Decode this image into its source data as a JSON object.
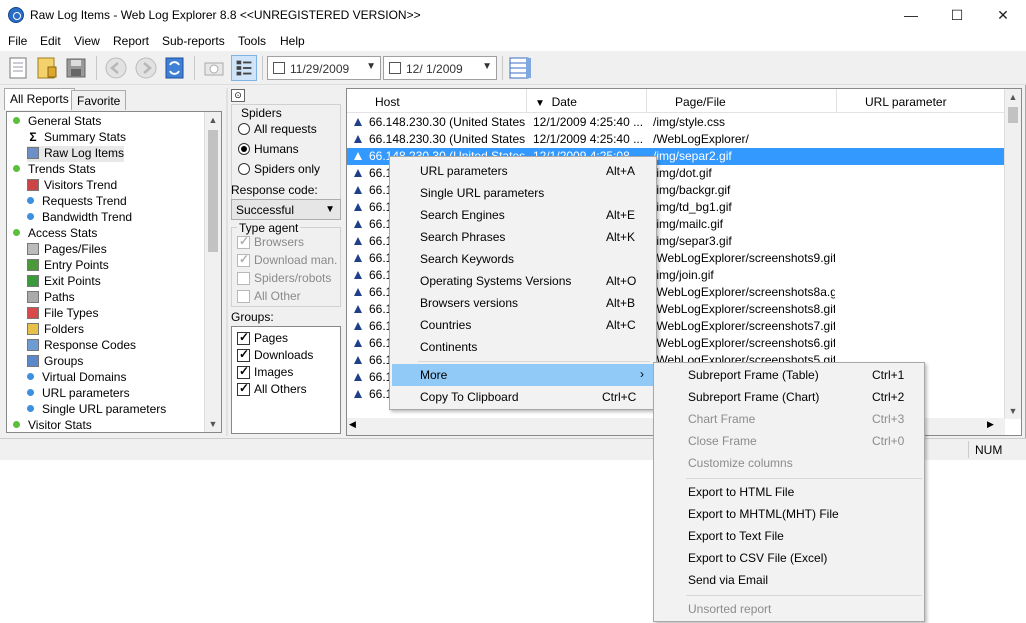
{
  "window": {
    "title": "Raw Log Items - Web Log Explorer 8.8 <<UNREGISTERED VERSION>>",
    "minimize": "—",
    "maximize": "☐",
    "close": "✕"
  },
  "menubar": [
    "File",
    "Edit",
    "View",
    "Report",
    "Sub-reports",
    "Tools",
    "Help"
  ],
  "toolbar": {
    "date_from": "11/29/2009",
    "date_to": "12/  1/2009",
    "icons": [
      "new-report-icon",
      "open-icon",
      "save-icon",
      "back-icon",
      "forward-icon",
      "refresh-icon",
      "snapshot-icon",
      "filter-panel-icon",
      "columns-icon"
    ]
  },
  "left_panel": {
    "tabs": [
      "All Reports",
      "Favorite"
    ],
    "tree": [
      {
        "label": "General Stats",
        "level": 0,
        "icon": "dot-green"
      },
      {
        "label": "Summary Stats",
        "level": 1,
        "icon": "sigma-icon"
      },
      {
        "label": "Raw Log Items",
        "level": 1,
        "icon": "list-icon"
      },
      {
        "label": "Trends Stats",
        "level": 0,
        "icon": "dot-green"
      },
      {
        "label": "Visitors Trend",
        "level": 1,
        "icon": "visitors-icon"
      },
      {
        "label": "Requests Trend",
        "level": 1,
        "icon": "dot-blue"
      },
      {
        "label": "Bandwidth Trend",
        "level": 1,
        "icon": "dot-blue"
      },
      {
        "label": "Access Stats",
        "level": 0,
        "icon": "dot-green"
      },
      {
        "label": "Pages/Files",
        "level": 1,
        "icon": "pages-icon"
      },
      {
        "label": "Entry Points",
        "level": 1,
        "icon": "entry-icon"
      },
      {
        "label": "Exit Points",
        "level": 1,
        "icon": "exit-icon"
      },
      {
        "label": "Paths",
        "level": 1,
        "icon": "paths-icon"
      },
      {
        "label": "File Types",
        "level": 1,
        "icon": "filetypes-icon"
      },
      {
        "label": "Folders",
        "level": 1,
        "icon": "folder-icon"
      },
      {
        "label": "Response Codes",
        "level": 1,
        "icon": "response-icon"
      },
      {
        "label": "Groups",
        "level": 1,
        "icon": "groups-icon"
      },
      {
        "label": "Virtual Domains",
        "level": 1,
        "icon": "dot-blue"
      },
      {
        "label": "URL parameters",
        "level": 1,
        "icon": "dot-blue"
      },
      {
        "label": "Single URL parameters",
        "level": 1,
        "icon": "dot-blue"
      },
      {
        "label": "Visitor Stats",
        "level": 0,
        "icon": "dot-green"
      }
    ]
  },
  "filter": {
    "spiders_label": "Spiders",
    "spider_options": [
      {
        "label": "All requests",
        "checked": false
      },
      {
        "label": "Humans",
        "checked": true
      },
      {
        "label": "Spiders only",
        "checked": false
      }
    ],
    "response_label": "Response code:",
    "response_value": "Successful",
    "type_agent_label": "Type agent",
    "agents": [
      {
        "label": "Browsers",
        "checked": true
      },
      {
        "label": "Download man.",
        "checked": true
      },
      {
        "label": "Spiders/robots",
        "checked": false
      },
      {
        "label": "All Other",
        "checked": false
      }
    ],
    "groups_label": "Groups:",
    "groups": [
      {
        "label": "Pages",
        "checked": true
      },
      {
        "label": "Downloads",
        "checked": true
      },
      {
        "label": "Images",
        "checked": true
      },
      {
        "label": "All Others",
        "checked": true
      }
    ]
  },
  "grid": {
    "columns": [
      "Host",
      "Date",
      "Page/File",
      "URL parameter"
    ],
    "rows": [
      {
        "host": "66.148.230.30 (United States)",
        "date": "12/1/2009 4:25:40 ...",
        "page": "/img/style.css",
        "selected": false
      },
      {
        "host": "66.148.230.30 (United States)",
        "date": "12/1/2009 4:25:40 ...",
        "page": "/WebLogExplorer/",
        "selected": false
      },
      {
        "host": "66.148.230.30 (United States)",
        "date": "12/1/2009 4:25:08",
        "page": "/img/separ2.gif",
        "selected": true
      },
      {
        "host": "66.1",
        "date": "",
        "page": "/img/dot.gif",
        "selected": false
      },
      {
        "host": "66.1",
        "date": "",
        "page": "/img/backgr.gif",
        "selected": false
      },
      {
        "host": "66.1",
        "date": "",
        "page": "/img/td_bg1.gif",
        "selected": false
      },
      {
        "host": "66.1",
        "date": "",
        "page": "/img/mailc.gif",
        "selected": false
      },
      {
        "host": "66.1",
        "date": "",
        "page": "/img/separ3.gif",
        "selected": false
      },
      {
        "host": "66.1",
        "date": "",
        "page": "/WebLogExplorer/screenshots9.gif",
        "selected": false
      },
      {
        "host": "66.1",
        "date": "",
        "page": "/img/join.gif",
        "selected": false
      },
      {
        "host": "66.1",
        "date": "",
        "page": "/WebLogExplorer/screenshots8a.gif",
        "selected": false
      },
      {
        "host": "66.1",
        "date": "",
        "page": "/WebLogExplorer/screenshots8.gif",
        "selected": false
      },
      {
        "host": "66.1",
        "date": "",
        "page": "/WebLogExplorer/screenshots7.gif",
        "selected": false
      },
      {
        "host": "66.1",
        "date": "",
        "page": "/WebLogExplorer/screenshots6.gif",
        "selected": false
      },
      {
        "host": "66.1",
        "date": "",
        "page": "/WebLogExplorer/screenshots5.gif",
        "selected": false
      },
      {
        "host": "66.1",
        "date": "",
        "page": "",
        "selected": false
      },
      {
        "host": "66.148.230.30 (United States)",
        "date": "12/1/2009 4:25:01 ...",
        "page": "",
        "selected": false
      }
    ]
  },
  "status": {
    "num": "NUM"
  },
  "context_menu": {
    "items": [
      {
        "label": "URL parameters",
        "shortcut": "Alt+A"
      },
      {
        "label": "Single URL parameters",
        "shortcut": ""
      },
      {
        "label": "Search Engines",
        "shortcut": "Alt+E"
      },
      {
        "label": "Search Phrases",
        "shortcut": "Alt+K"
      },
      {
        "label": "Search Keywords",
        "shortcut": ""
      },
      {
        "label": "Operating Systems Versions",
        "shortcut": "Alt+O"
      },
      {
        "label": "Browsers versions",
        "shortcut": "Alt+B"
      },
      {
        "label": "Countries",
        "shortcut": "Alt+C"
      },
      {
        "label": "Continents",
        "shortcut": ""
      }
    ],
    "more": "More",
    "copy": {
      "label": "Copy To Clipboard",
      "shortcut": "Ctrl+C"
    }
  },
  "submenu": {
    "group1": [
      {
        "label": "Subreport Frame (Table)",
        "shortcut": "Ctrl+1",
        "disabled": false
      },
      {
        "label": "Subreport Frame (Chart)",
        "shortcut": "Ctrl+2",
        "disabled": false
      },
      {
        "label": "Chart Frame",
        "shortcut": "Ctrl+3",
        "disabled": true
      },
      {
        "label": "Close Frame",
        "shortcut": "Ctrl+0",
        "disabled": true
      },
      {
        "label": "Customize columns",
        "shortcut": "",
        "disabled": true
      }
    ],
    "group2": [
      {
        "label": "Export to HTML File",
        "disabled": false
      },
      {
        "label": "Export to MHTML(MHT) File",
        "disabled": false
      },
      {
        "label": "Export to Text File",
        "disabled": false
      },
      {
        "label": "Export to CSV File (Excel)",
        "disabled": false
      },
      {
        "label": "Send via Email",
        "disabled": false
      }
    ],
    "group3": [
      {
        "label": "Unsorted report",
        "disabled": true
      }
    ]
  }
}
